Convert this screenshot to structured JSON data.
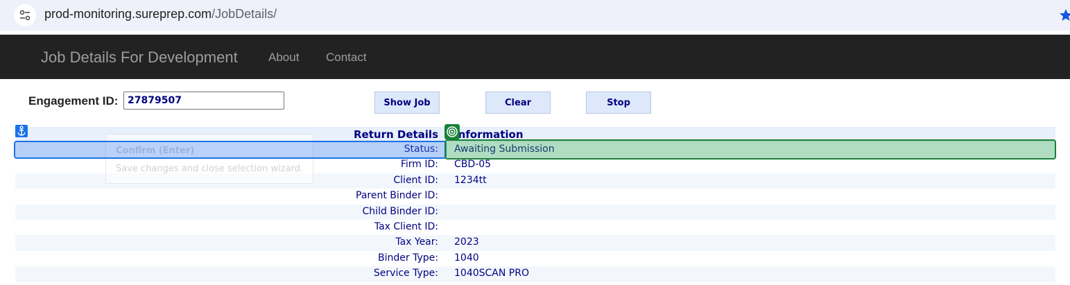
{
  "browser": {
    "url_host": "prod-monitoring.sureprep.com",
    "url_path": "/JobDetails/"
  },
  "navbar": {
    "brand": "Job Details For Development",
    "links": [
      "About",
      "Contact"
    ]
  },
  "form": {
    "engagement_label": "Engagement ID:",
    "engagement_value": "27879507",
    "buttons": {
      "show_job": "Show Job",
      "clear": "Clear",
      "stop": "Stop"
    }
  },
  "details": {
    "header": {
      "label": "Return Details",
      "value": "Information"
    },
    "rows": [
      {
        "label": "Status:",
        "value": "Awaiting Submission"
      },
      {
        "label": "Firm ID:",
        "value": "CBD-05"
      },
      {
        "label": "Client ID:",
        "value": "1234tt"
      },
      {
        "label": "Parent Binder ID:",
        "value": ""
      },
      {
        "label": "Child Binder ID:",
        "value": ""
      },
      {
        "label": "Tax Client ID:",
        "value": ""
      },
      {
        "label": "Tax Year:",
        "value": "2023"
      },
      {
        "label": "Binder Type:",
        "value": "1040"
      },
      {
        "label": "Service Type:",
        "value": "1040SCAN PRO"
      }
    ]
  },
  "overlay": {
    "tooltip_title": "Confirm (Enter)",
    "tooltip_text": "Save changes and close selection wizard."
  },
  "icons": {
    "site_info": "tune-icon",
    "bookmark": "star-icon",
    "anchor": "anchor-icon",
    "target": "target-icon"
  },
  "colors": {
    "navbar_bg": "#222222",
    "accent_text": "#000080",
    "selection_blue": "#1a73e8",
    "selection_green": "#188038"
  }
}
